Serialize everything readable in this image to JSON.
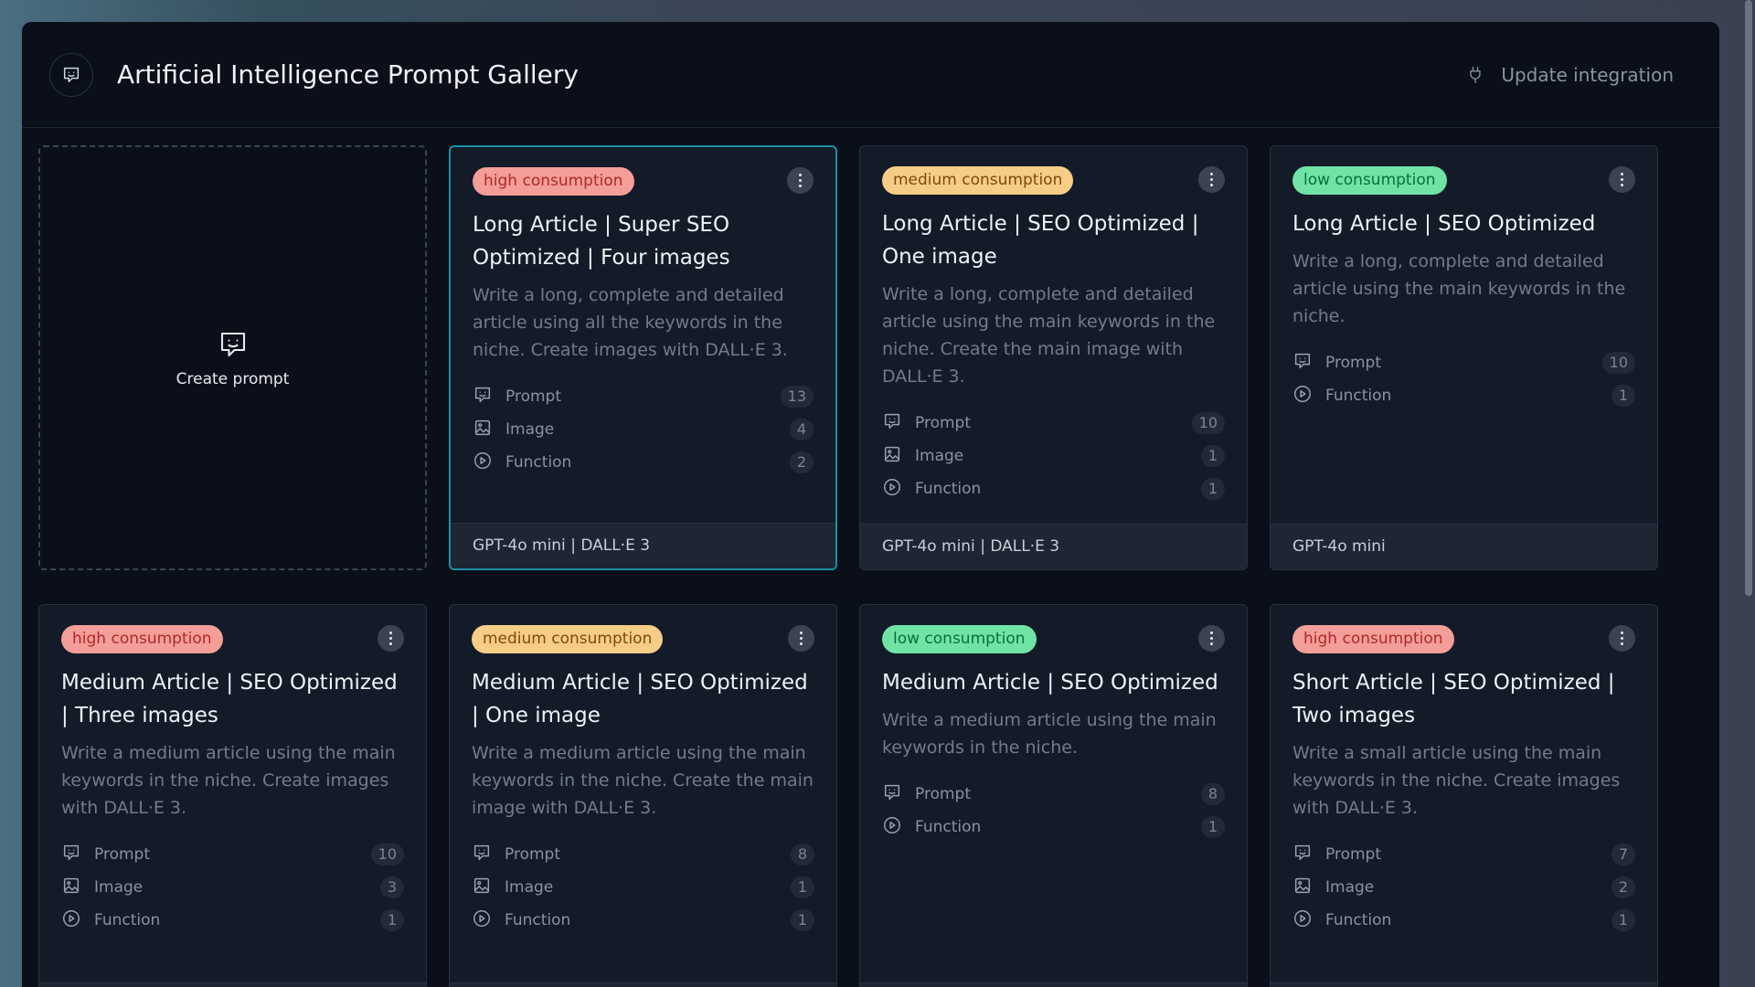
{
  "header": {
    "title": "Artificial Intelligence Prompt Gallery",
    "update_label": "Update integration",
    "logo_icon": "chat-smile-icon",
    "plug_icon": "plug-icon"
  },
  "create": {
    "label": "Create prompt",
    "icon": "chat-smile-icon"
  },
  "cards": [
    {
      "badge": "high consumption",
      "level": "high",
      "title": "Long Article | Super SEO Optimized | Four images",
      "description": "Write a long, complete and detailed article using all the keywords in the niche. Create images with DALL·E 3.",
      "stats": [
        {
          "label": "Prompt",
          "count": "13",
          "icon": "prompt"
        },
        {
          "label": "Image",
          "count": "4",
          "icon": "image"
        },
        {
          "label": "Function",
          "count": "2",
          "icon": "function"
        }
      ],
      "footer": "GPT-4o mini | DALL·E 3",
      "selected": true
    },
    {
      "badge": "medium consumption",
      "level": "medium",
      "title": "Long Article | SEO Optimized | One image",
      "description": "Write a long, complete and detailed article using the main keywords in the niche. Create the main image with DALL·E 3.",
      "stats": [
        {
          "label": "Prompt",
          "count": "10",
          "icon": "prompt"
        },
        {
          "label": "Image",
          "count": "1",
          "icon": "image"
        },
        {
          "label": "Function",
          "count": "1",
          "icon": "function"
        }
      ],
      "footer": "GPT-4o mini | DALL·E 3",
      "selected": false
    },
    {
      "badge": "low consumption",
      "level": "low",
      "title": "Long Article | SEO Optimized",
      "description": "Write a long, complete and detailed article using the main keywords in the niche.",
      "stats": [
        {
          "label": "Prompt",
          "count": "10",
          "icon": "prompt"
        },
        {
          "label": "Function",
          "count": "1",
          "icon": "function"
        }
      ],
      "footer": "GPT-4o mini",
      "selected": false
    },
    {
      "badge": "high consumption",
      "level": "high",
      "title": "Medium Article | SEO Optimized | Three images",
      "description": "Write a medium article using the main keywords in the niche. Create images with DALL·E 3.",
      "stats": [
        {
          "label": "Prompt",
          "count": "10",
          "icon": "prompt"
        },
        {
          "label": "Image",
          "count": "3",
          "icon": "image"
        },
        {
          "label": "Function",
          "count": "1",
          "icon": "function"
        }
      ],
      "footer": "",
      "selected": false
    },
    {
      "badge": "medium consumption",
      "level": "medium",
      "title": "Medium Article | SEO Optimized | One image",
      "description": "Write a medium article using the main keywords in the niche. Create the main image with DALL·E 3.",
      "stats": [
        {
          "label": "Prompt",
          "count": "8",
          "icon": "prompt"
        },
        {
          "label": "Image",
          "count": "1",
          "icon": "image"
        },
        {
          "label": "Function",
          "count": "1",
          "icon": "function"
        }
      ],
      "footer": "",
      "selected": false
    },
    {
      "badge": "low consumption",
      "level": "low",
      "title": "Medium Article | SEO Optimized",
      "description": "Write a medium article using the main keywords in the niche.",
      "stats": [
        {
          "label": "Prompt",
          "count": "8",
          "icon": "prompt"
        },
        {
          "label": "Function",
          "count": "1",
          "icon": "function"
        }
      ],
      "footer": "",
      "selected": false
    },
    {
      "badge": "high consumption",
      "level": "high",
      "title": "Short Article | SEO Optimized | Two images",
      "description": "Write a small article using the main keywords in the niche. Create images with DALL·E 3.",
      "stats": [
        {
          "label": "Prompt",
          "count": "7",
          "icon": "prompt"
        },
        {
          "label": "Image",
          "count": "2",
          "icon": "image"
        },
        {
          "label": "Function",
          "count": "1",
          "icon": "function"
        }
      ],
      "footer": "",
      "selected": false
    }
  ],
  "colors": {
    "accent": "#1b8fa8",
    "high_bg": "#f49e99",
    "medium_bg": "#f6cd87",
    "low_bg": "#6fe4a5",
    "panel_bg": "#0a0f19",
    "card_bg": "#141b28"
  }
}
